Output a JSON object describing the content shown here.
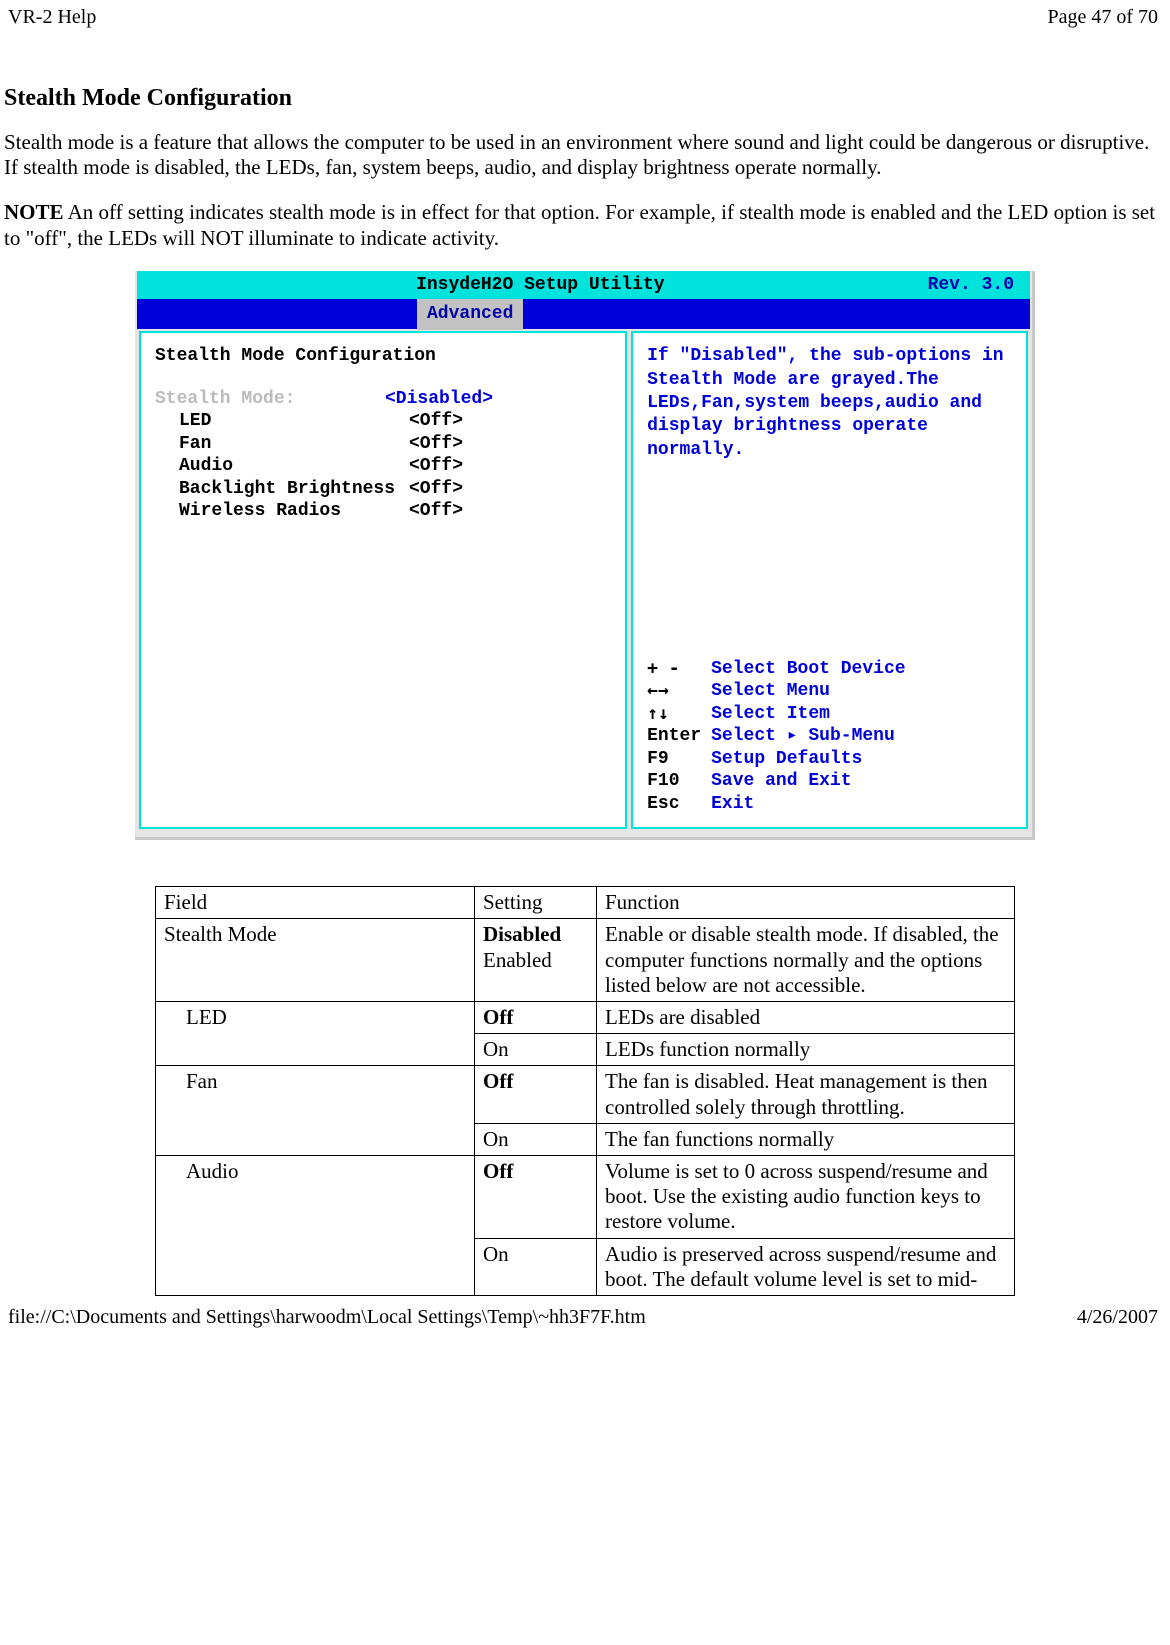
{
  "header": {
    "left": "VR-2 Help",
    "right": "Page 47 of 70"
  },
  "footer": {
    "left": "file://C:\\Documents and Settings\\harwoodm\\Local Settings\\Temp\\~hh3F7F.htm",
    "right": "4/26/2007"
  },
  "title": "Stealth Mode Configuration",
  "para1": "Stealth mode is a feature that allows the computer to be used in an environment where sound and light could be dangerous or disruptive. If stealth mode is disabled, the LEDs, fan, system beeps, audio, and display brightness operate normally.",
  "note_label": "NOTE",
  "para2": "  An off setting indicates stealth mode is in effect for that option. For example, if stealth mode is enabled and the LED option is set to \"off\", the LEDs will NOT illuminate to indicate activity.",
  "bios": {
    "util": "InsydeH2O Setup Utility",
    "rev": "Rev. 3.0",
    "tab": "Advanced",
    "section": "Stealth Mode Configuration",
    "items": {
      "stealth_lbl": "Stealth Mode:",
      "stealth_val": "<Disabled>",
      "led_lbl": "LED",
      "led_val": "<Off>",
      "fan_lbl": "Fan",
      "fan_val": "<Off>",
      "audio_lbl": "Audio",
      "audio_val": "<Off>",
      "bright_lbl": "Backlight Brightness",
      "bright_val": "<Off>",
      "radio_lbl": "Wireless Radios",
      "radio_val": "<Off>"
    },
    "help": "If \"Disabled\", the sub-options in Stealth Mode are grayed.The LEDs,Fan,system beeps,audio and display brightness operate normally.",
    "keys": {
      "k1": "+ -",
      "v1": "Select Boot Device",
      "k2": "←→",
      "v2": "Select Menu",
      "k3": "↑↓",
      "v3": "Select Item",
      "k4": "Enter",
      "v4": "Select ▸ Sub-Menu",
      "k5": "F9",
      "v5": "Setup Defaults",
      "k6": "F10",
      "v6": "Save and Exit",
      "k7": "Esc",
      "v7": "Exit"
    }
  },
  "table": {
    "hdr": {
      "field": "Field",
      "setting": "Setting",
      "function": "Function"
    },
    "rows": {
      "stealth_field": "Stealth Mode",
      "stealth_set1": "Disabled",
      "stealth_set2": "Enabled",
      "stealth_fn": "Enable or disable stealth mode. If disabled, the computer functions normally and the options listed below are not accessible.",
      "led_field": "LED",
      "led_off": "Off",
      "led_off_fn": "LEDs are disabled",
      "led_on": "On",
      "led_on_fn": "LEDs function normally",
      "fan_field": "Fan",
      "fan_off": "Off",
      "fan_off_fn": "The fan is disabled. Heat management is then controlled solely through throttling.",
      "fan_on": "On",
      "fan_on_fn": "The fan functions normally",
      "audio_field": "Audio",
      "audio_off": "Off",
      "audio_off_fn": "Volume is set to 0 across suspend/resume and boot. Use the existing audio function keys to restore volume.",
      "audio_on": "On",
      "audio_on_fn": "Audio is preserved across suspend/resume and boot. The default volume level is set to mid-"
    }
  }
}
